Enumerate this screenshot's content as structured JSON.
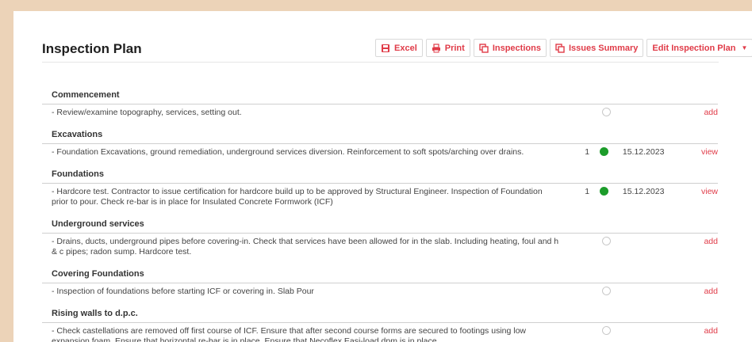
{
  "page": {
    "title": "Inspection Plan"
  },
  "toolbar": {
    "excel_label": "Excel",
    "print_label": "Print",
    "inspections_label": "Inspections",
    "issues_label": "Issues Summary",
    "edit_label": "Edit Inspection Plan"
  },
  "colors": {
    "accent": "#e03b48",
    "done": "#1c9c2a",
    "background": "#ecd3b8"
  },
  "sections": [
    {
      "title": "Commencement",
      "items": [
        {
          "text": "- Review/examine topography, services, setting out.",
          "count": "",
          "status": "empty",
          "date": "",
          "action": "add"
        }
      ]
    },
    {
      "title": "Excavations",
      "items": [
        {
          "text": "- Foundation Excavations, ground remediation, underground services diversion. Reinforcement to soft spots/arching over drains.",
          "count": "1",
          "status": "done",
          "date": "15.12.2023",
          "action": "view"
        }
      ]
    },
    {
      "title": "Foundations",
      "items": [
        {
          "text": "- Hardcore test. Contractor to issue certification for hardcore build up to be approved by Structural Engineer. Inspection of Foundation prior to pour. Check re-bar is in place for Insulated Concrete Formwork (ICF)",
          "count": "1",
          "status": "done",
          "date": "15.12.2023",
          "action": "view"
        }
      ]
    },
    {
      "title": "Underground services",
      "items": [
        {
          "text": "- Drains, ducts, underground pipes before covering-in. Check that services have been allowed for in the slab. Including heating, foul and h & c pipes; radon sump. Hardcore test.",
          "count": "",
          "status": "empty",
          "date": "",
          "action": "add"
        }
      ]
    },
    {
      "title": "Covering Foundations",
      "items": [
        {
          "text": "- Inspection of foundations before starting ICF or covering in. Slab Pour",
          "count": "",
          "status": "empty",
          "date": "",
          "action": "add"
        }
      ]
    },
    {
      "title": "Rising walls to d.p.c.",
      "items": [
        {
          "text": "- Check castellations are removed off first course of ICF. Ensure that after second course forms are secured to footings using low expansion foam. Ensure that horizontal re-bar is in place. Ensure that Necoflex Easi-load dpm is in place.",
          "count": "",
          "status": "empty",
          "date": "",
          "action": "add"
        }
      ]
    }
  ]
}
